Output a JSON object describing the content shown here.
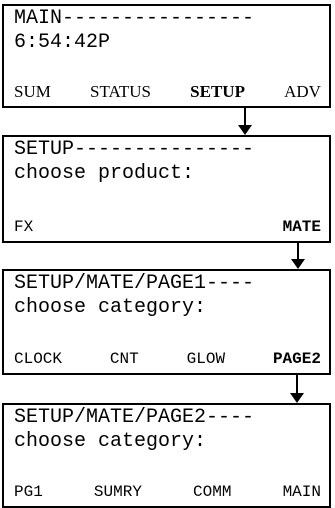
{
  "screens": [
    {
      "line1": "MAIN----------------",
      "line2": "6:54:42P",
      "keys": [
        "SUM",
        "STATUS",
        "SETUP",
        "ADV"
      ],
      "selected": "SETUP"
    },
    {
      "line1": "SETUP---------------",
      "line2": "choose product:",
      "keys": [
        "FX",
        "MATE"
      ],
      "selected": "MATE"
    },
    {
      "line1": "SETUP/MATE/PAGE1----",
      "line2": "choose category:",
      "keys": [
        "CLOCK",
        "CNT",
        "GLOW",
        "PAGE2"
      ],
      "selected": "PAGE2"
    },
    {
      "line1": "SETUP/MATE/PAGE2----",
      "line2": "choose category:",
      "keys": [
        "PG1",
        "SUMRY",
        "COMM",
        "MAIN"
      ],
      "selected": ""
    }
  ]
}
